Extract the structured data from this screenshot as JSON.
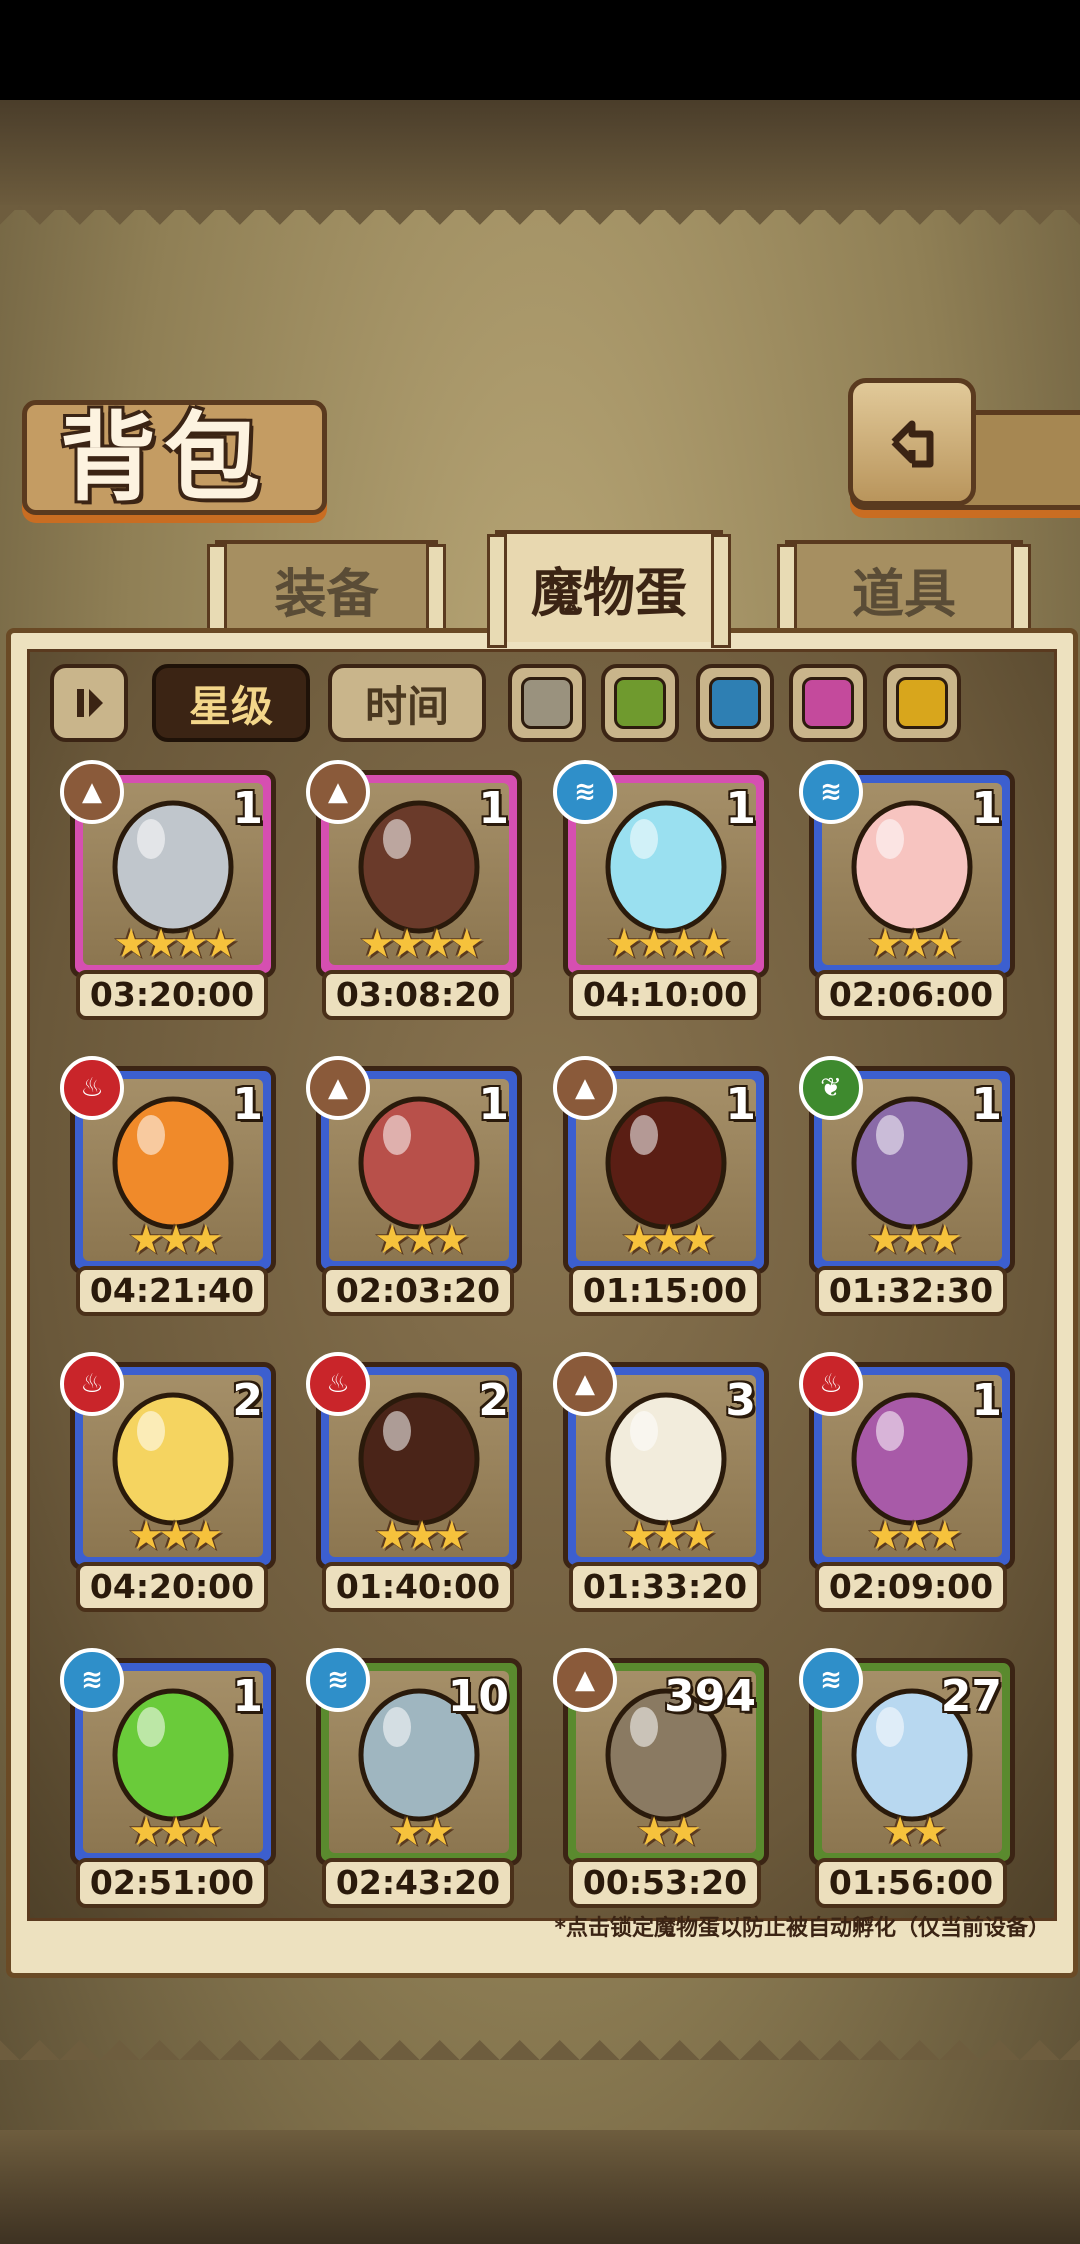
{
  "title": "背包",
  "tabs": [
    {
      "label": "装备",
      "active": false
    },
    {
      "label": "魔物蛋",
      "active": true
    },
    {
      "label": "道具",
      "active": false
    }
  ],
  "sort_buttons": [
    {
      "label": "星级",
      "active": true
    },
    {
      "label": "时间",
      "active": false
    }
  ],
  "color_filters": [
    "#9a927e",
    "#6f9a2e",
    "#2e7fb3",
    "#c44a9c",
    "#d8a61c"
  ],
  "element_colors": {
    "earth": "#8a5a3a",
    "water": "#2f8fc9",
    "fire": "#c9252a",
    "nature": "#3e8a2e"
  },
  "element_icons": {
    "earth": "mountain-icon",
    "water": "wave-icon",
    "fire": "flame-icon",
    "nature": "leaf-icon"
  },
  "rarity_colors": {
    "pink": "#d64fb1",
    "blue": "#3c5fcf",
    "green": "#5a8a2e"
  },
  "eggs": [
    {
      "count": "1",
      "stars": 4,
      "time": "03:20:00",
      "element": "earth",
      "rarity": "pink",
      "art": "#c0c6cc"
    },
    {
      "count": "1",
      "stars": 4,
      "time": "03:08:20",
      "element": "earth",
      "rarity": "pink",
      "art": "#6a3a2a"
    },
    {
      "count": "1",
      "stars": 4,
      "time": "04:10:00",
      "element": "water",
      "rarity": "pink",
      "art": "#9ae0f0"
    },
    {
      "count": "1",
      "stars": 3,
      "time": "02:06:00",
      "element": "water",
      "rarity": "blue",
      "art": "#f7c4c0"
    },
    {
      "count": "1",
      "stars": 3,
      "time": "04:21:40",
      "element": "fire",
      "rarity": "blue",
      "art": "#f08a2a"
    },
    {
      "count": "1",
      "stars": 3,
      "time": "02:03:20",
      "element": "earth",
      "rarity": "blue",
      "art": "#b8504a"
    },
    {
      "count": "1",
      "stars": 3,
      "time": "01:15:00",
      "element": "earth",
      "rarity": "blue",
      "art": "#5a1e14"
    },
    {
      "count": "1",
      "stars": 3,
      "time": "01:32:30",
      "element": "nature",
      "rarity": "blue",
      "art": "#8a6aa8"
    },
    {
      "count": "2",
      "stars": 3,
      "time": "04:20:00",
      "element": "fire",
      "rarity": "blue",
      "art": "#f5d460"
    },
    {
      "count": "2",
      "stars": 3,
      "time": "01:40:00",
      "element": "fire",
      "rarity": "blue",
      "art": "#4a2418"
    },
    {
      "count": "3",
      "stars": 3,
      "time": "01:33:20",
      "element": "earth",
      "rarity": "blue",
      "art": "#f2ecdc"
    },
    {
      "count": "1",
      "stars": 3,
      "time": "02:09:00",
      "element": "fire",
      "rarity": "blue",
      "art": "#a85aa8"
    },
    {
      "count": "1",
      "stars": 3,
      "time": "02:51:00",
      "element": "water",
      "rarity": "blue",
      "art": "#6acb3a"
    },
    {
      "count": "10",
      "stars": 2,
      "time": "02:43:20",
      "element": "water",
      "rarity": "green",
      "art": "#9fb6c0"
    },
    {
      "count": "394",
      "stars": 2,
      "time": "00:53:20",
      "element": "earth",
      "rarity": "green",
      "art": "#8a7a62"
    },
    {
      "count": "27",
      "stars": 2,
      "time": "01:56:00",
      "element": "water",
      "rarity": "green",
      "art": "#b8d8f0"
    }
  ],
  "footnote": "*点击锁定魔物蛋以防止被自动孵化（仅当前设备）"
}
